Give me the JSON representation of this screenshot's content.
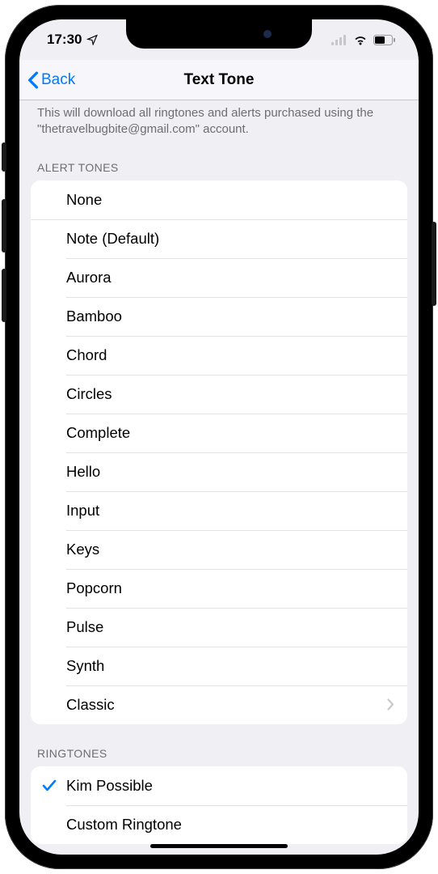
{
  "status": {
    "time": "17:30"
  },
  "nav": {
    "back": "Back",
    "title": "Text Tone"
  },
  "downloadText": "This will download all ringtones and alerts purchased using the \"thetravelbugbite@gmail.com\" account.",
  "sections": {
    "alertTones": {
      "header": "ALERT TONES",
      "items": [
        {
          "label": "None"
        },
        {
          "label": "Note (Default)"
        },
        {
          "label": "Aurora"
        },
        {
          "label": "Bamboo"
        },
        {
          "label": "Chord"
        },
        {
          "label": "Circles"
        },
        {
          "label": "Complete"
        },
        {
          "label": "Hello"
        },
        {
          "label": "Input"
        },
        {
          "label": "Keys"
        },
        {
          "label": "Popcorn"
        },
        {
          "label": "Pulse"
        },
        {
          "label": "Synth"
        },
        {
          "label": "Classic",
          "disclosure": true
        }
      ]
    },
    "ringtones": {
      "header": "RINGTONES",
      "items": [
        {
          "label": "Kim Possible",
          "selected": true
        },
        {
          "label": "Custom Ringtone"
        }
      ]
    }
  }
}
